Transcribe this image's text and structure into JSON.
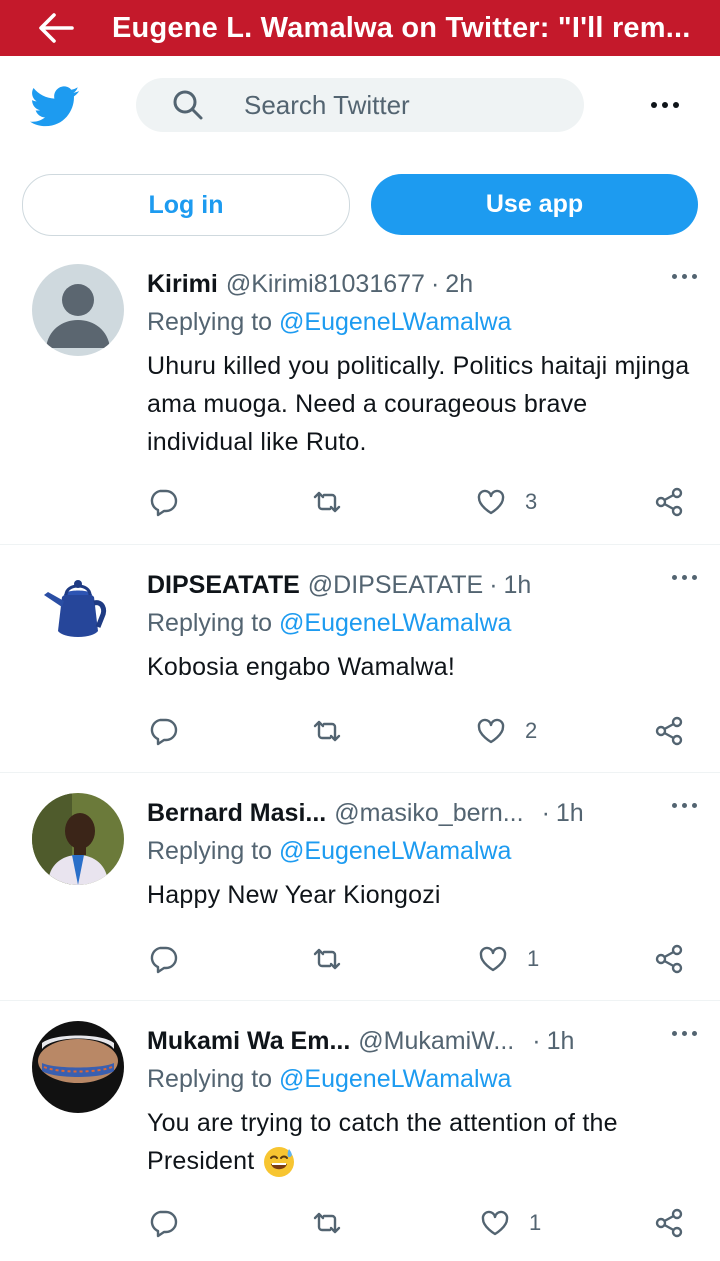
{
  "page": {
    "title": "Eugene L. Wamalwa on Twitter: \"I'll rem..."
  },
  "header": {
    "search_placeholder": "Search Twitter"
  },
  "buttons": {
    "login": "Log in",
    "use_app": "Use app"
  },
  "colors": {
    "brand_red": "#c4192b",
    "twitter_blue": "#1d9bf0"
  },
  "tweets": [
    {
      "name": "Kirimi",
      "handle": "@Kirimi81031677",
      "sep": "·",
      "time": "2h",
      "reply_prefix": "Replying to",
      "reply_to": "@EugeneLWamalwa",
      "text": "Uhuru killed you politically. Politics haitaji mjinga ama muoga. Need a courageous brave individual like Ruto.",
      "likes": "3"
    },
    {
      "name": "DIPSEATATE",
      "handle": "@DIPSEATATE",
      "sep": "·",
      "time": "1h",
      "reply_prefix": "Replying to",
      "reply_to": "@EugeneLWamalwa",
      "text": "Kobosia engabo Wamalwa!",
      "likes": "2"
    },
    {
      "name": "Bernard Masi...",
      "handle": "@masiko_bern...",
      "sep": "·",
      "time": "1h",
      "reply_prefix": "Replying to",
      "reply_to": "@EugeneLWamalwa",
      "text": "Happy New Year Kiongozi",
      "likes": "1"
    },
    {
      "name": "Mukami Wa Em...",
      "handle": "@MukamiW...",
      "sep": "·",
      "time": "1h",
      "reply_prefix": "Replying to",
      "reply_to": "@EugeneLWamalwa",
      "text": "You are trying to catch the attention of the President",
      "likes": "1"
    }
  ]
}
